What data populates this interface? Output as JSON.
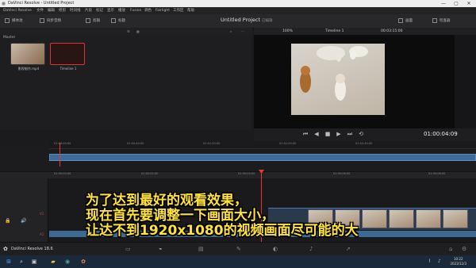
{
  "window": {
    "title": "DaVinci Resolve - Untitled Project",
    "controls": [
      "—",
      "▢",
      "✕"
    ]
  },
  "menu": [
    "DaVinci Resolve",
    "文件",
    "编辑",
    "修剪",
    "时间线",
    "片段",
    "标记",
    "显示",
    "播放",
    "Fusion",
    "调色",
    "Fairlight",
    "工作区",
    "帮助"
  ],
  "toolbar": {
    "left_buttons": [
      "媒体池",
      "同步音频",
      "剪辑",
      "标题"
    ],
    "project_title": "Untitled Project",
    "project_status": "已编辑",
    "right_buttons": [
      "画面",
      "检查器"
    ]
  },
  "media_pool": {
    "header": "Master",
    "clips": [
      {
        "label": "影视制作.mp4"
      },
      {
        "label": "Timeline 1"
      }
    ]
  },
  "viewer": {
    "timeline_name": "Timeline 1",
    "zoom": "100%",
    "source_timecode": "00:03:15:00",
    "record_timecode": "01:00:04:09"
  },
  "timeline": {
    "ruler1_ticks": [
      "01:00:00:00",
      "01:00:40:00",
      "01:01:20:00",
      "01:02:00:00",
      "01:02:40:00"
    ],
    "ruler2_ticks": [
      "01:00:00:00",
      "01:00:02:00",
      "01:00:04:00",
      "01:00:06:00",
      "01:00:08:00"
    ],
    "video_track": "V1",
    "audio_track": "A1"
  },
  "subtitle": {
    "line1": "为了达到最好的观看效果，",
    "line2": "现在首先要调整一下画面大小，",
    "line3": "让达不到1920x1080的视频画面尽可能的大"
  },
  "pages": {
    "app_name": "DaVinci Resolve 18.6"
  },
  "taskbar": {
    "time": "10:22",
    "date": "2023/12/3"
  }
}
